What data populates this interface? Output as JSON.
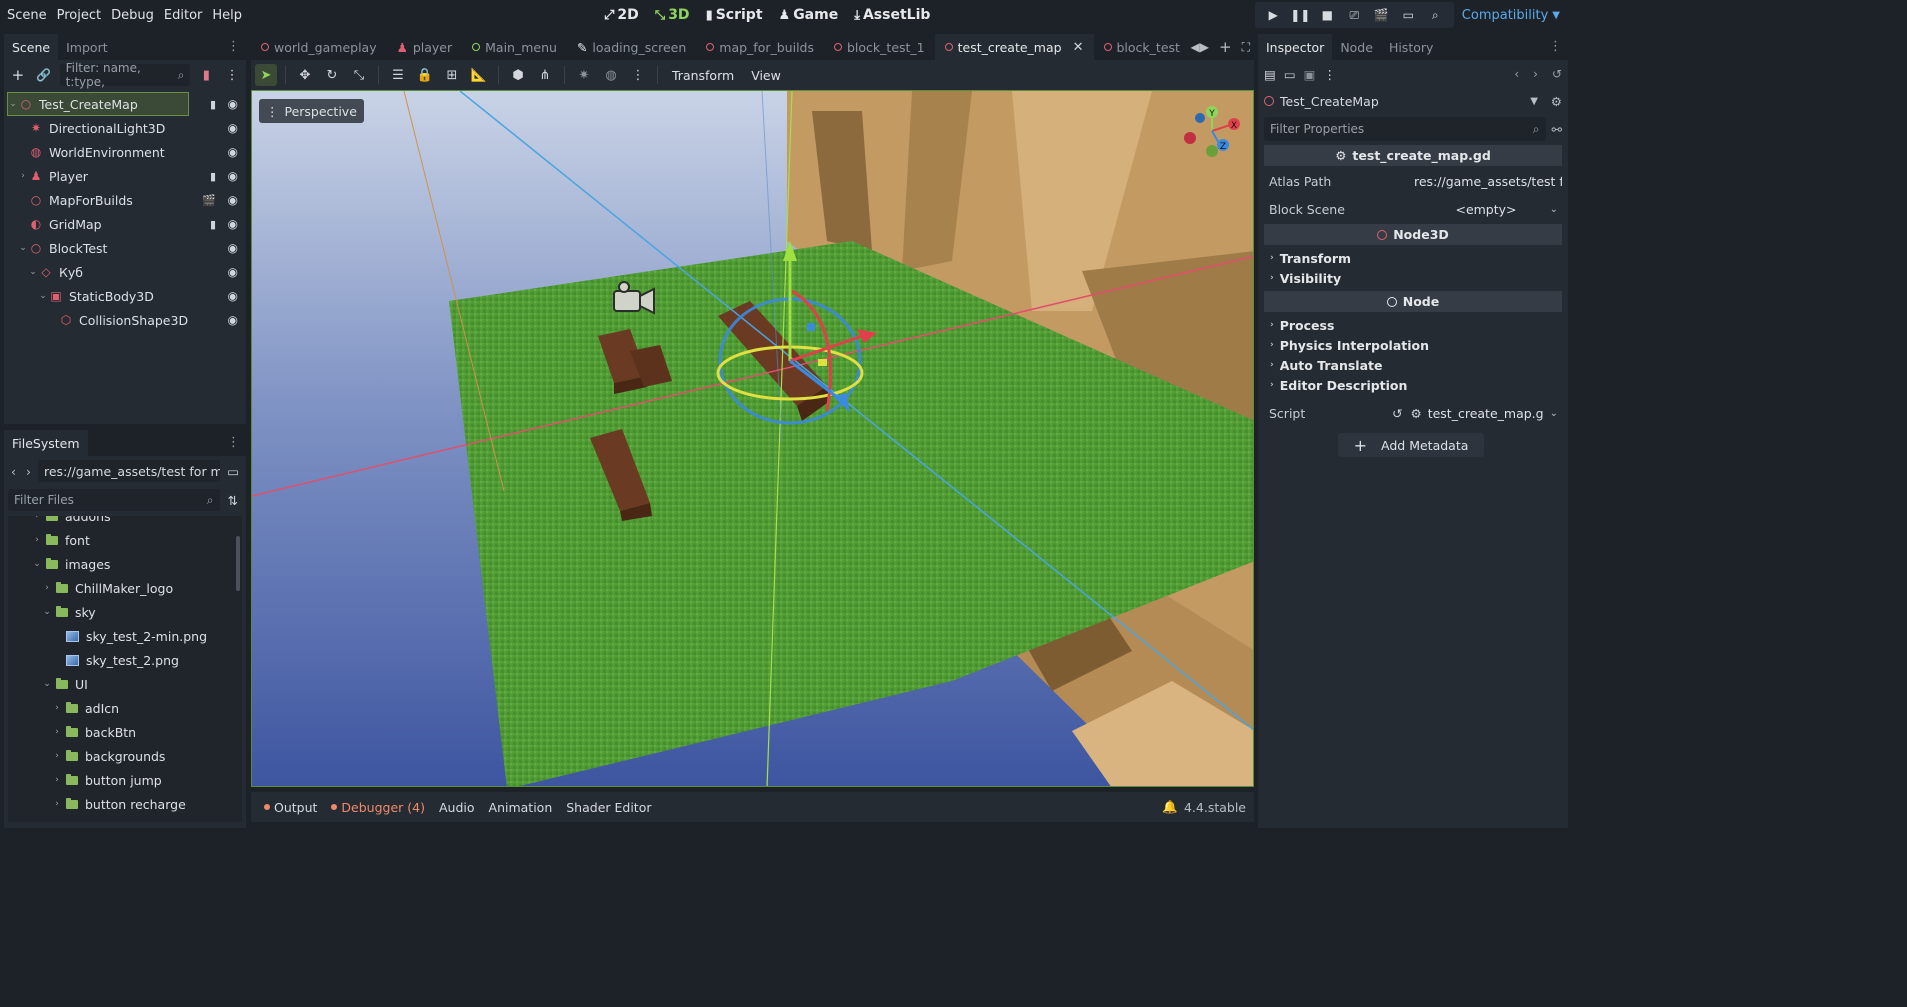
{
  "menus": [
    "Scene",
    "Project",
    "Debug",
    "Editor",
    "Help"
  ],
  "modes": [
    {
      "label": "2D",
      "icon": "⤢",
      "active": false
    },
    {
      "label": "3D",
      "icon": "⤡",
      "active": true
    },
    {
      "label": "Script",
      "icon": "▮",
      "active": false
    },
    {
      "label": "Game",
      "icon": "♟",
      "active": false
    },
    {
      "label": "AssetLib",
      "icon": "⤓",
      "active": false
    }
  ],
  "renderer": "Compatibility",
  "scene_dock": {
    "tabs": [
      "Scene",
      "Import"
    ],
    "filter_placeholder": "Filter: name, t:type,",
    "nodes": [
      {
        "label": "Test_CreateMap",
        "icon": "○",
        "color": "#e06070",
        "indent": 0,
        "arrow": "⌄",
        "selected": true,
        "extra": "▮"
      },
      {
        "label": "DirectionalLight3D",
        "icon": "✷",
        "color": "#e06070",
        "indent": 1,
        "arrow": "",
        "selected": false,
        "extra": ""
      },
      {
        "label": "WorldEnvironment",
        "icon": "◍",
        "color": "#e06070",
        "indent": 1,
        "arrow": "",
        "selected": false,
        "extra": ""
      },
      {
        "label": "Player",
        "icon": "♟",
        "color": "#e06070",
        "indent": 1,
        "arrow": "›",
        "selected": false,
        "extra": "▮"
      },
      {
        "label": "MapForBuilds",
        "icon": "○",
        "color": "#e06070",
        "indent": 1,
        "arrow": "",
        "selected": false,
        "extra": "🎬"
      },
      {
        "label": "GridMap",
        "icon": "◐",
        "color": "#e06070",
        "indent": 1,
        "arrow": "",
        "selected": false,
        "extra": "▮"
      },
      {
        "label": "BlockTest",
        "icon": "○",
        "color": "#e06070",
        "indent": 1,
        "arrow": "⌄",
        "selected": false,
        "extra": ""
      },
      {
        "label": "Куб",
        "icon": "◇",
        "color": "#e06070",
        "indent": 2,
        "arrow": "⌄",
        "selected": false,
        "extra": ""
      },
      {
        "label": "StaticBody3D",
        "icon": "▣",
        "color": "#e06070",
        "indent": 3,
        "arrow": "⌄",
        "selected": false,
        "extra": ""
      },
      {
        "label": "CollisionShape3D",
        "icon": "⬡",
        "color": "#e06070",
        "indent": 4,
        "arrow": "",
        "selected": false,
        "extra": ""
      }
    ]
  },
  "filesystem": {
    "tab": "FileSystem",
    "path": "res://game_assets/test for mo",
    "filter_placeholder": "Filter Files",
    "items": [
      {
        "label": "addons",
        "type": "folder",
        "indent": 2,
        "arrow": "›"
      },
      {
        "label": "font",
        "type": "folder",
        "indent": 2,
        "arrow": "›"
      },
      {
        "label": "images",
        "type": "folder",
        "indent": 2,
        "arrow": "⌄"
      },
      {
        "label": "ChillMaker_logo",
        "type": "folder",
        "indent": 3,
        "arrow": "›"
      },
      {
        "label": "sky",
        "type": "folder",
        "indent": 3,
        "arrow": "⌄"
      },
      {
        "label": "sky_test_2-min.png",
        "type": "image",
        "indent": 4,
        "arrow": ""
      },
      {
        "label": "sky_test_2.png",
        "type": "image",
        "indent": 4,
        "arrow": ""
      },
      {
        "label": "UI",
        "type": "folder",
        "indent": 3,
        "arrow": "⌄"
      },
      {
        "label": "adIcn",
        "type": "folder",
        "indent": 4,
        "arrow": "›"
      },
      {
        "label": "backBtn",
        "type": "folder",
        "indent": 4,
        "arrow": "›"
      },
      {
        "label": "backgrounds",
        "type": "folder",
        "indent": 4,
        "arrow": "›"
      },
      {
        "label": "button jump",
        "type": "folder",
        "indent": 4,
        "arrow": "›"
      },
      {
        "label": "button recharge",
        "type": "folder",
        "indent": 4,
        "arrow": "›"
      }
    ]
  },
  "scene_tabs": [
    {
      "label": "world_gameplay",
      "dot": "red",
      "active": false
    },
    {
      "label": "player",
      "dot": "person",
      "active": false
    },
    {
      "label": "Main_menu",
      "dot": "green",
      "active": false
    },
    {
      "label": "loading_screen",
      "dot": "brush",
      "active": false
    },
    {
      "label": "map_for_builds",
      "dot": "red",
      "active": false
    },
    {
      "label": "block_test_1",
      "dot": "red",
      "active": false
    },
    {
      "label": "test_create_map",
      "dot": "red",
      "active": true
    },
    {
      "label": "block_test",
      "dot": "red",
      "active": false
    }
  ],
  "viewport": {
    "menus": [
      "Transform",
      "View"
    ],
    "perspective_label": "Perspective",
    "gizmo_axes": [
      "Y",
      "X",
      "Z"
    ]
  },
  "bottom_panels": [
    {
      "label": "Output",
      "dot": true,
      "warn": false
    },
    {
      "label": "Debugger (4)",
      "dot": true,
      "warn": true
    },
    {
      "label": "Audio",
      "dot": false,
      "warn": false
    },
    {
      "label": "Animation",
      "dot": false,
      "warn": false
    },
    {
      "label": "Shader Editor",
      "dot": false,
      "warn": false
    }
  ],
  "version": "4.4.stable",
  "inspector": {
    "tabs": [
      "Inspector",
      "Node",
      "History"
    ],
    "object_name": "Test_CreateMap",
    "filter_placeholder": "Filter Properties",
    "script_header": "test_create_map.gd",
    "props": [
      {
        "label": "Atlas Path",
        "value": "res://game_assets/test fo"
      },
      {
        "label": "Block Scene",
        "value": "<empty>"
      }
    ],
    "node3d_header": "Node3D",
    "node3d_groups": [
      "Transform",
      "Visibility"
    ],
    "node_header": "Node",
    "node_groups": [
      "Process",
      "Physics Interpolation",
      "Auto Translate",
      "Editor Description"
    ],
    "script_label": "Script",
    "script_value": "test_create_map.g",
    "add_metadata": "Add Metadata"
  },
  "colors": {
    "accent_green": "#8fd45c",
    "node_red": "#e06070",
    "renderer_blue": "#5aa9e8",
    "warning": "#f08a6a"
  }
}
